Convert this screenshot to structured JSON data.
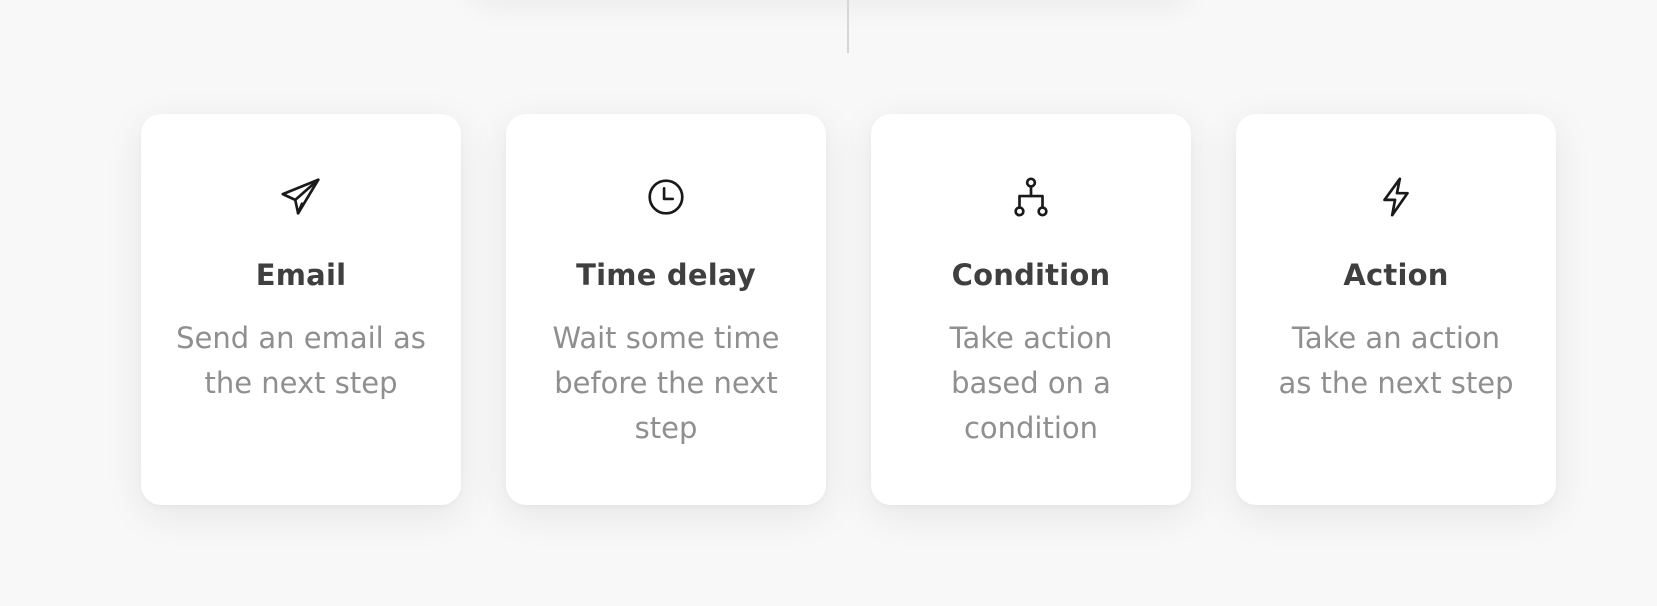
{
  "cards": [
    {
      "icon": "paper-plane-icon",
      "title": "Email",
      "description": "Send an email as the next step"
    },
    {
      "icon": "clock-icon",
      "title": "Time delay",
      "description": "Wait some time before the next step"
    },
    {
      "icon": "branch-icon",
      "title": "Condition",
      "description": "Take action based on a condition"
    },
    {
      "icon": "lightning-icon",
      "title": "Action",
      "description": "Take an action as the next step"
    }
  ],
  "colors": {
    "background": "#f8f8f8",
    "card": "#ffffff",
    "title": "#3f3f3f",
    "description": "#8f8f8f",
    "icon": "#1a1a1a"
  }
}
